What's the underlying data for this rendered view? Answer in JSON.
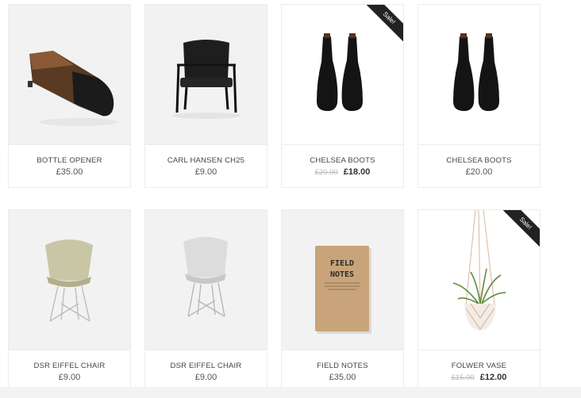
{
  "products": [
    {
      "name": "BOTTLE OPENER",
      "price": "£35.00",
      "old_price": "",
      "sale": false,
      "sale_label": "",
      "icon": "bottle-opener-image"
    },
    {
      "name": "CARL HANSEN CH25",
      "price": "£9.00",
      "old_price": "",
      "sale": false,
      "sale_label": "",
      "icon": "armchair-image"
    },
    {
      "name": "CHELSEA BOOTS",
      "price": "£18.00",
      "old_price": "£20.00",
      "sale": true,
      "sale_label": "Sale!",
      "icon": "boots-image"
    },
    {
      "name": "CHELSEA BOOTS",
      "price": "£20.00",
      "old_price": "",
      "sale": false,
      "sale_label": "",
      "icon": "boots-image"
    },
    {
      "name": "DSR EIFFEL CHAIR",
      "price": "£9.00",
      "old_price": "",
      "sale": false,
      "sale_label": "",
      "icon": "chair-image"
    },
    {
      "name": "DSR EIFFEL CHAIR",
      "price": "£9.00",
      "old_price": "",
      "sale": false,
      "sale_label": "",
      "icon": "chair-image"
    },
    {
      "name": "FIELD NOTES",
      "price": "£35.00",
      "old_price": "",
      "sale": false,
      "sale_label": "",
      "icon": "notebook-image",
      "cover_title_1": "FIELD",
      "cover_title_2": "NOTES"
    },
    {
      "name": "FOLWER VASE",
      "price": "£12.00",
      "old_price": "£15.00",
      "sale": true,
      "sale_label": "Sale!",
      "icon": "hanging-plant-image"
    }
  ],
  "colors": {
    "image_bg": "#f2f2f2",
    "ribbon": "#222222",
    "notebook": "#c9a47a"
  }
}
